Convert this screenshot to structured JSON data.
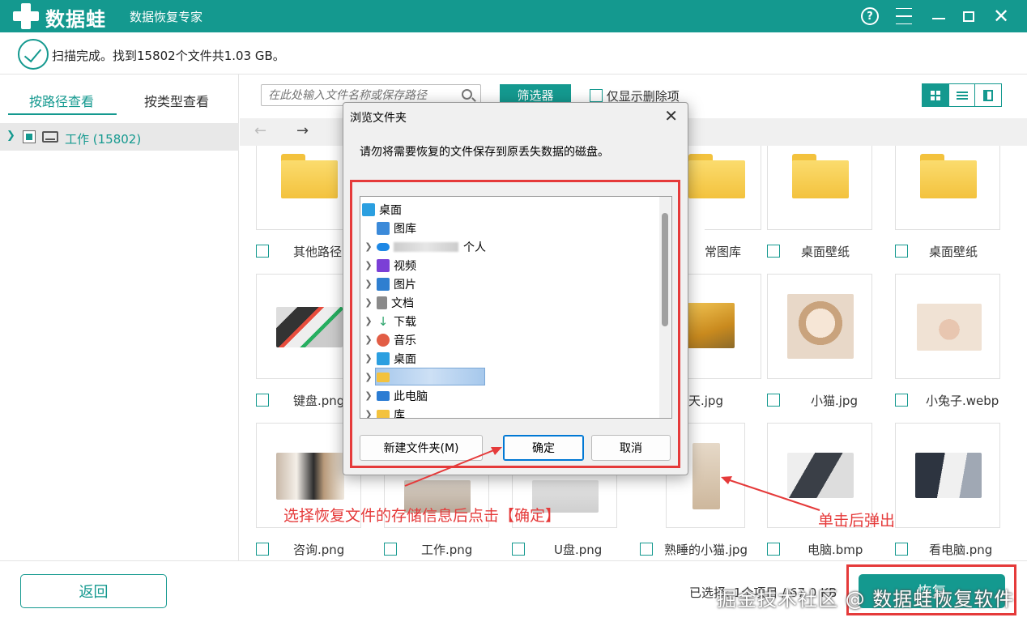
{
  "app": {
    "logo_text": "数据蛙",
    "title": "数据恢复专家",
    "brand_color": "#14998f"
  },
  "status": {
    "text": "扫描完成。找到15802个文件共1.03 GB。"
  },
  "left_tabs": [
    {
      "label": "按路径查看",
      "active": true
    },
    {
      "label": "按类型查看",
      "active": false
    }
  ],
  "tree": {
    "label": "工作 (15802)"
  },
  "toolbar": {
    "search_placeholder": "在此处输入文件名称或保存路径",
    "filter_label": "筛选器",
    "only_deleted_label": "仅显示删除项"
  },
  "files": [
    {
      "name": "其他路径",
      "type": "folder"
    },
    {
      "name": "常图库",
      "type": "folder"
    },
    {
      "name": "桌面壁纸",
      "type": "folder"
    },
    {
      "name": "桌面壁纸",
      "type": "folder"
    },
    {
      "name": "键盘.png",
      "type": "image"
    },
    {
      "name": "天.jpg",
      "type": "image"
    },
    {
      "name": "小猫.jpg",
      "type": "image"
    },
    {
      "name": "小兔子.webp",
      "type": "image"
    },
    {
      "name": "咨询.png",
      "type": "image"
    },
    {
      "name": "工作.png",
      "type": "image"
    },
    {
      "name": "U盘.png",
      "type": "image"
    },
    {
      "name": "熟睡的小猫.jpg",
      "type": "image"
    },
    {
      "name": "电脑.bmp",
      "type": "image"
    },
    {
      "name": "看电脑.png",
      "type": "image"
    }
  ],
  "bottom": {
    "back_label": "返回",
    "selected_info": "已选择: 1个项目 / 67.0 KB",
    "recover_label": "恢复",
    "watermark": "掘金技术社区 @ 数据蛙恢复软件"
  },
  "dialog": {
    "title": "浏览文件夹",
    "message": "请勿将需要恢复的文件保存到原丢失数据的磁盘。",
    "items": [
      {
        "label": "桌面",
        "icon": "desktop-icon",
        "color": "#2b9fe0"
      },
      {
        "label": "图库",
        "icon": "gallery-icon",
        "color": "#3b8ad9"
      },
      {
        "label": "个人",
        "icon": "onedrive-icon",
        "color": "#1e88e5"
      },
      {
        "label": "视频",
        "icon": "video-icon",
        "color": "#7b3fd6"
      },
      {
        "label": "图片",
        "icon": "pictures-icon",
        "color": "#2f7fd0"
      },
      {
        "label": "文档",
        "icon": "documents-icon",
        "color": "#8a8a8a"
      },
      {
        "label": "下载",
        "icon": "download-icon",
        "color": "#2aa36a"
      },
      {
        "label": "音乐",
        "icon": "music-icon",
        "color": "#e25d45"
      },
      {
        "label": "桌面",
        "icon": "desktop-icon",
        "color": "#2b9fe0"
      },
      {
        "label": "",
        "icon": "folder-icon",
        "color": "#f3c23d"
      },
      {
        "label": "此电脑",
        "icon": "computer-icon",
        "color": "#2b7cd3"
      },
      {
        "label": "库",
        "icon": "folder-icon",
        "color": "#f3c23d"
      }
    ],
    "new_folder_label": "新建文件夹(M)",
    "ok_label": "确定",
    "cancel_label": "取消"
  },
  "annotations": {
    "left_text": "选择恢复文件的存储信息后点击【确定】",
    "right_text": "单击后弹出",
    "color": "#e53a3a"
  }
}
